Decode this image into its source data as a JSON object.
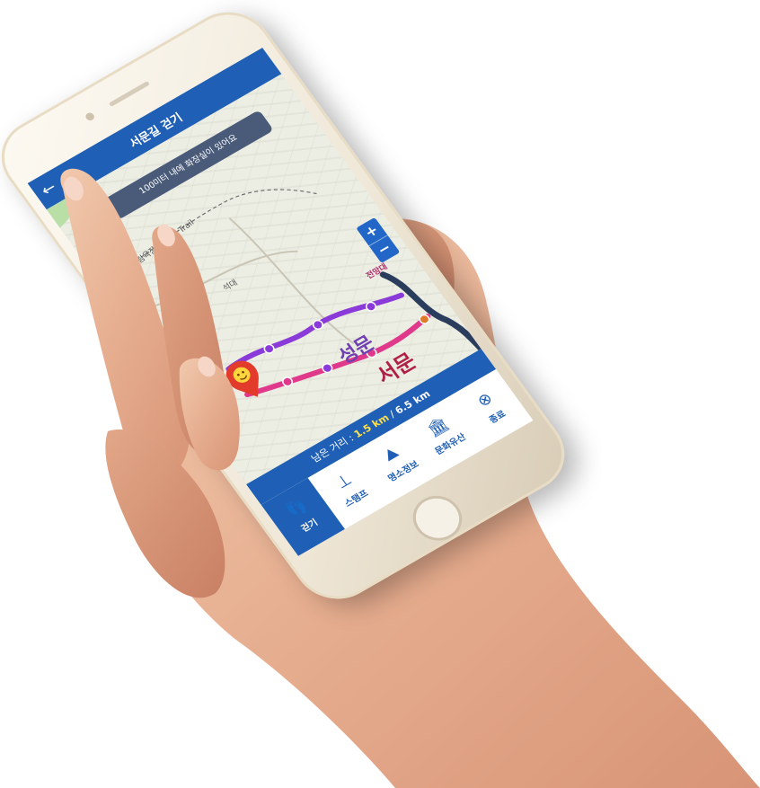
{
  "app": {
    "title": "서문길 걷기",
    "back_icon": "arrow-left-icon"
  },
  "map": {
    "notice": "100미터 내에 화장실이 있어요",
    "zoom_in_label": "+",
    "zoom_out_label": "−",
    "labels": {
      "trail_name": "삼림욕장 Forest Trail",
      "hill": "석대",
      "peak": "전망대",
      "gate_small": "성문",
      "gate_big": "서문"
    },
    "route_colors": {
      "purple": "#8a3ad8",
      "pink": "#e0388b",
      "navy": "#2a3d5c",
      "marker": "#e33b2b"
    }
  },
  "distance": {
    "label": "남은 거리 :",
    "remaining": "1.5 km",
    "separator": "/",
    "total": "6.5 km"
  },
  "tabs": [
    {
      "label": "걷기",
      "icon": "footprints-icon",
      "glyph": "👣",
      "active": true
    },
    {
      "label": "스탬프",
      "icon": "stamp-icon",
      "glyph": "⊥",
      "active": false
    },
    {
      "label": "명소정보",
      "icon": "landmark-info-icon",
      "glyph": "⛰",
      "active": false
    },
    {
      "label": "문화유산",
      "icon": "heritage-icon",
      "glyph": "🏛",
      "active": false
    },
    {
      "label": "종료",
      "icon": "close-circle-icon",
      "glyph": "⊗",
      "active": false
    }
  ],
  "colors": {
    "primary": "#1f5fb5",
    "highlight": "#ffe14a",
    "bubble": "#4a5a79"
  }
}
